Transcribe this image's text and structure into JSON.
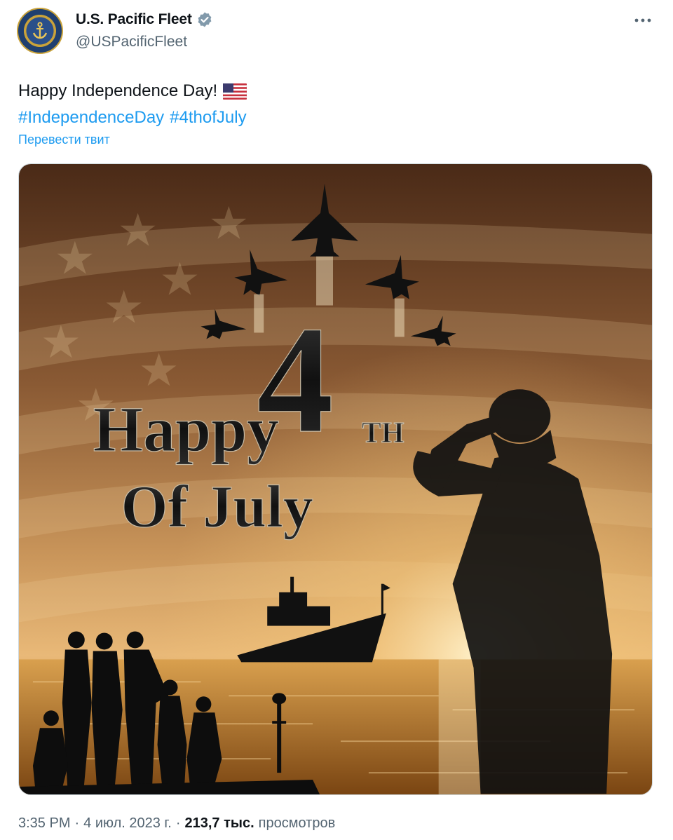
{
  "tweet": {
    "author_name": "U.S. Pacific Fleet",
    "author_handle": "@USPacificFleet",
    "verified_icon": "verified-badge-icon",
    "more_icon": "more-options-icon",
    "text_line1": "Happy Independence Day!",
    "flag_icon": "us-flag-emoji",
    "hashtags": [
      "#IndependenceDay",
      "#4thofJuly"
    ],
    "translate_label": "Перевести твит",
    "time": "3:35 PM",
    "separator": "·",
    "date": "4 июл. 2023 г.",
    "separator2": "·",
    "views_count": "213,7 тыс.",
    "views_label": "просмотров"
  },
  "media": {
    "big_number": "4",
    "superscript": "TH",
    "line1": "Happy",
    "line2": "Of July"
  },
  "colors": {
    "link": "#1d9bf0",
    "secondary_text": "#536471",
    "verified": "#829aab"
  }
}
